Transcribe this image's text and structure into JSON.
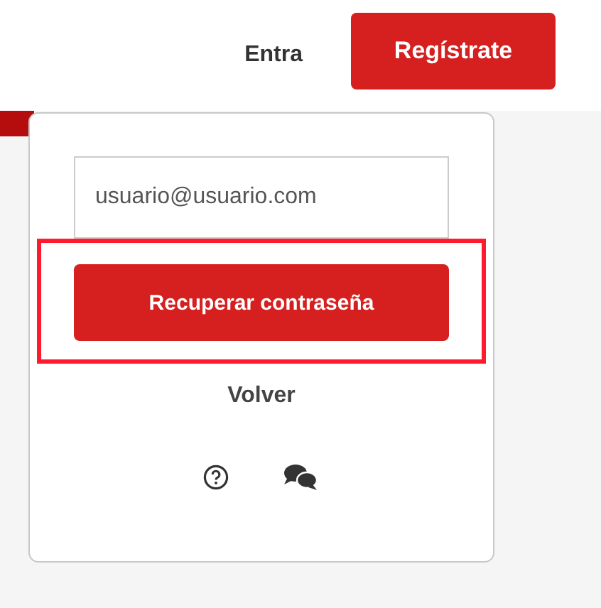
{
  "header": {
    "actions": [
      {
        "kind": "link",
        "label": "Entra"
      },
      {
        "kind": "button",
        "label": "Regístrate"
      }
    ]
  },
  "popup": {
    "email_field": {
      "value": "usuario@usuario.com"
    },
    "submit_button": {
      "label": "Recuperar contraseña",
      "highlighted": true
    },
    "back_link": {
      "label": "Volver"
    }
  }
}
